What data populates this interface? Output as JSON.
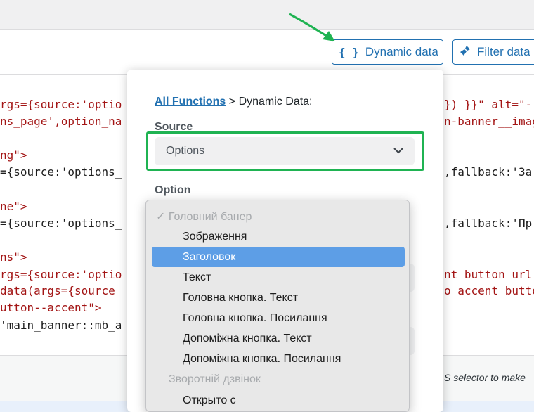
{
  "toolbar": {
    "dynamic_data_label": "Dynamic data",
    "dynamic_data_icon": "{ }",
    "filter_data_label": "Filter data",
    "filter_icon": "broom-icon"
  },
  "editor": {
    "lines": [
      {
        "left": "rgs={source:'optio",
        "right": "}) }}\" alt=\"-"
      },
      {
        "left": "ns_page',option_na",
        "right": "n-banner__imag"
      },
      {
        "left": "ng\">",
        "right": ""
      },
      {
        "left": "={source:'options_",
        "right": ",fallback:'За"
      },
      {
        "left": "ne\">",
        "right": ""
      },
      {
        "left": "={source:'options_",
        "right": ",fallback:'Пр"
      },
      {
        "left": "ns\">",
        "right": ""
      },
      {
        "left": "rgs={source:'optio",
        "right": "nt_button_url'"
      },
      {
        "left": "data(args={source",
        "right": "o_accent_butto"
      },
      {
        "left": "utton--accent\">",
        "right": ""
      },
      {
        "left": "'main_banner::mb_a",
        "right": ""
      }
    ]
  },
  "footer": {
    "hint": "S selector to make"
  },
  "panel": {
    "breadcrumb_link": "All Functions",
    "breadcrumb_rest": " > Dynamic Data:",
    "source_label": "Source",
    "source_value": "Options",
    "option_label": "Option"
  },
  "dropdown": {
    "group1": "✓ Головний банер",
    "items": [
      "Зображення",
      "Заголовок",
      "Текст",
      "Головна кнопка. Текст",
      "Головна кнопка. Посилання",
      "Допоміжна кнопка. Текст",
      "Допоміжна кнопка. Посилання"
    ],
    "selected_index": 1,
    "group2": "Зворотній дзвінок",
    "items2": [
      "Открыто с"
    ]
  },
  "colors": {
    "accent": "#2271b1",
    "highlight_green": "#1fb352",
    "selected_bg": "#5d9ee6",
    "code_red": "#a31515"
  }
}
